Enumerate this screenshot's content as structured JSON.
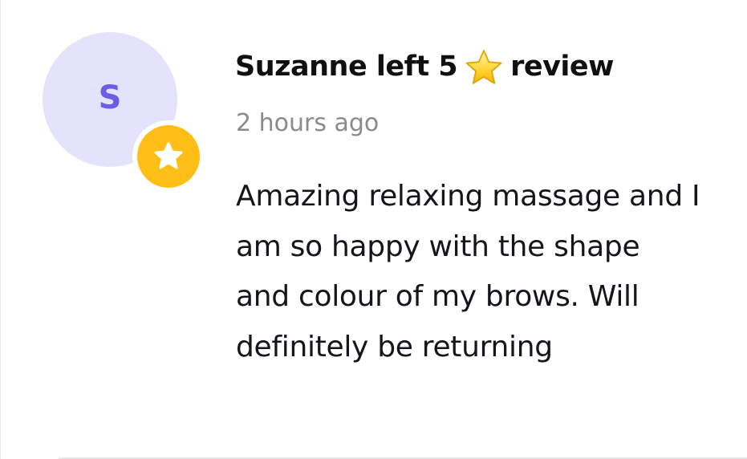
{
  "review": {
    "avatar_initial": "S",
    "title_prefix": "Suzanne left 5",
    "title_suffix": "review",
    "time": "2 hours ago",
    "text": "Amazing relaxing massage and I am so happy with the shape and colour of my brows. Will definitely be returning",
    "rating": 5
  },
  "icons": {
    "avatar_badge": "star-icon",
    "title_star": "star-emoji-icon"
  },
  "colors": {
    "avatar_bg": "#e4e3fb",
    "avatar_text": "#6e5be6",
    "badge": "#ffbf17",
    "title": "#101010",
    "time": "#8a8a8f",
    "body": "#15151a"
  }
}
